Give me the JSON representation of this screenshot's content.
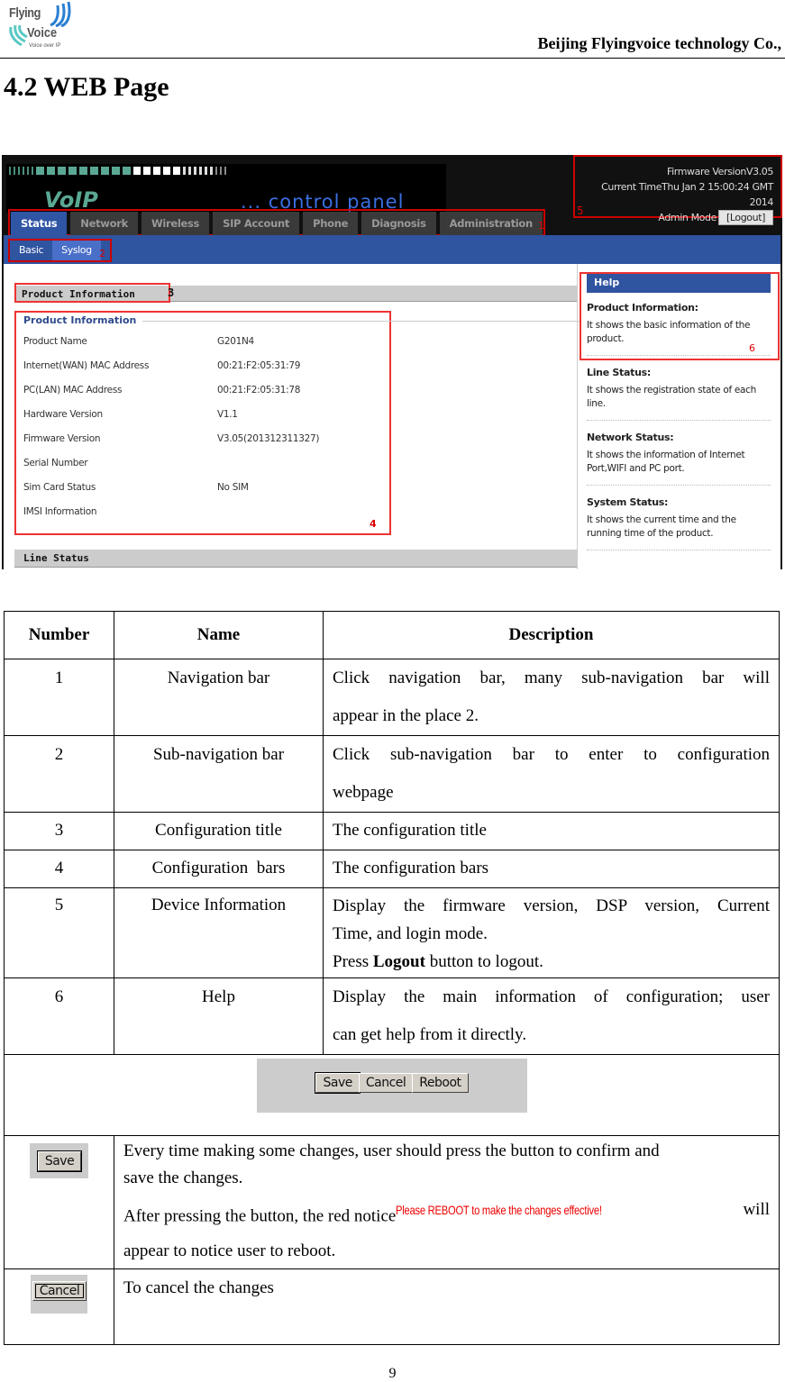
{
  "page_header": {
    "logo": {
      "line1": "Flying",
      "line2": "Voice",
      "tagline": "Voice over IP"
    },
    "company": "Beijing Flyingvoice technology Co.,"
  },
  "section_title": "4.2 WEB Page",
  "screenshot": {
    "banner": {
      "brand": "VoIP",
      "subtitle": "... control panel"
    },
    "device_info": {
      "firmware": "Firmware VersionV3.05",
      "current_time": "Current TimeThu Jan 2 15:00:24 GMT 2014",
      "mode": "Admin Mode",
      "logout_label": "[Logout]",
      "marker": "5"
    },
    "nav": {
      "tabs": [
        {
          "label": "Status",
          "active": true
        },
        {
          "label": "Network"
        },
        {
          "label": "Wireless"
        },
        {
          "label": "SIP Account"
        },
        {
          "label": "Phone"
        },
        {
          "label": "Diagnosis"
        },
        {
          "label": "Administration"
        }
      ],
      "marker": "1"
    },
    "subnav": {
      "tabs": [
        {
          "label": "Basic"
        },
        {
          "label": "Syslog",
          "active": true
        }
      ],
      "marker": "2"
    },
    "config_title": {
      "label": "Product Information",
      "marker": "3"
    },
    "config_bars": {
      "legend": "Product Information",
      "marker": "4",
      "rows": [
        {
          "key": "Product Name",
          "value": "G201N4"
        },
        {
          "key": "Internet(WAN) MAC Address",
          "value": "00:21:F2:05:31:79"
        },
        {
          "key": "PC(LAN) MAC Address",
          "value": "00:21:F2:05:31:78"
        },
        {
          "key": "Hardware Version",
          "value": "V1.1"
        },
        {
          "key": "Firmware Version",
          "value": "V3.05(201312311327)"
        },
        {
          "key": "Serial Number",
          "value": ""
        },
        {
          "key": "Sim Card Status",
          "value": "No SIM"
        },
        {
          "key": "IMSI Information",
          "value": ""
        }
      ]
    },
    "line_status_title": "Line Status",
    "help": {
      "title": "Help",
      "marker": "6",
      "items": [
        {
          "title": "Product Information:",
          "desc": "It shows the basic information of the product."
        },
        {
          "title": "Line Status:",
          "desc": "It shows the registration state of each line."
        },
        {
          "title": "Network Status:",
          "desc": "It shows the information of Internet Port,WIFI and PC port."
        },
        {
          "title": "System Status:",
          "desc": "It shows the current time and the running time of the product."
        }
      ]
    }
  },
  "table": {
    "headers": [
      "Number",
      "Name",
      "Description"
    ],
    "rows": [
      {
        "number": "1",
        "name": "Navigation bar",
        "desc_line1": "Click navigation bar, many sub-navigation bar will",
        "desc_line2": "appear in the place 2."
      },
      {
        "number": "2",
        "name": "Sub-navigation bar",
        "desc_line1": "Click sub-navigation bar to enter to configuration",
        "desc_line2": "webpage"
      },
      {
        "number": "3",
        "name": "Configuration title",
        "desc": "The configuration title"
      },
      {
        "number": "4",
        "name": "Configuration  bars",
        "desc": "The configuration bars"
      },
      {
        "number": "5",
        "name": "Device Information",
        "desc_line1": "Display the firmware version, DSP version, Current",
        "desc_line2": "Time, and login mode.",
        "desc_line3_pre": "Press ",
        "desc_line3_bold": "Logout",
        "desc_line3_post": " button to logout."
      },
      {
        "number": "6",
        "name": "Help",
        "desc_line1": "Display the main information of configuration; user",
        "desc_line2": "can get help from it directly."
      }
    ],
    "button_bar": [
      "Save",
      "Cancel",
      "Reboot"
    ],
    "save_row": {
      "button_label": "Save",
      "line1": "Every time making some changes, user should press the button to confirm and",
      "line2": "save the changes.",
      "line3_pre": "After pressing the button, the red notice",
      "red_notice": "Please REBOOT to make the changes effective!",
      "line3_post": "will",
      "line4": "appear to notice user to reboot."
    },
    "cancel_row": {
      "button_label": "Cancel",
      "text": "To cancel the changes"
    }
  },
  "page_number": "9"
}
